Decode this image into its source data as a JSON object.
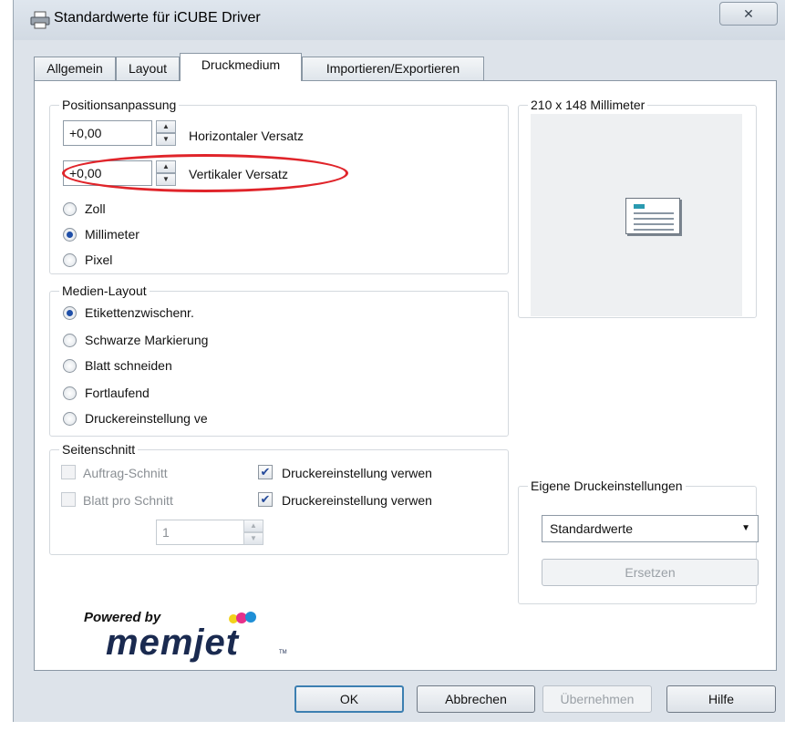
{
  "window": {
    "title": "Standardwerte für iCUBE Driver",
    "close_glyph": "✕"
  },
  "tabs": [
    {
      "label": "Allgemein",
      "active": false
    },
    {
      "label": "Layout",
      "active": false
    },
    {
      "label": "Druckmedium",
      "active": true
    },
    {
      "label": "Importieren/Exportieren",
      "active": false
    }
  ],
  "position": {
    "group_label": "Positionsanpassung",
    "horizontal": {
      "value": "+0,00",
      "label": "Horizontaler Versatz"
    },
    "vertical": {
      "value": "+0,00",
      "label": "Vertikaler Versatz"
    },
    "units": [
      {
        "label": "Zoll",
        "selected": false
      },
      {
        "label": "Millimeter",
        "selected": true
      },
      {
        "label": "Pixel",
        "selected": false
      }
    ]
  },
  "preview": {
    "label": "210 x 148 Millimeter"
  },
  "media_layout": {
    "group_label": "Medien-Layout",
    "options": [
      {
        "label": "Etikettenzwischenr.",
        "selected": true
      },
      {
        "label": "Schwarze Markierung",
        "selected": false
      },
      {
        "label": "Blatt schneiden",
        "selected": false
      },
      {
        "label": "Fortlaufend",
        "selected": false
      },
      {
        "label": "Druckereinstellung ve",
        "selected": false
      }
    ]
  },
  "page_cut": {
    "group_label": "Seitenschnitt",
    "job_cut": {
      "label": "Auftrag-Schnitt",
      "checked": false
    },
    "job_cut_printer": {
      "label": "Druckereinstellung verwen",
      "checked": true
    },
    "sheets_per_cut": {
      "label": "Blatt pro Schnitt",
      "checked": false
    },
    "sheets_per_cut_printer": {
      "label": "Druckereinstellung verwen",
      "checked": true
    },
    "count_value": "1"
  },
  "custom_settings": {
    "group_label": "Eigene Druckeinstellungen",
    "selected": "Standardwerte",
    "replace_label": "Ersetzen"
  },
  "logo": {
    "powered_by": "Powered by",
    "brand": "memjet",
    "tm": "TM"
  },
  "buttons": {
    "ok": "OK",
    "cancel": "Abbrechen",
    "apply": "Übernehmen",
    "help": "Hilfe"
  },
  "colors": {
    "highlight": "#e0242a",
    "accent": "#1f4fa8"
  }
}
